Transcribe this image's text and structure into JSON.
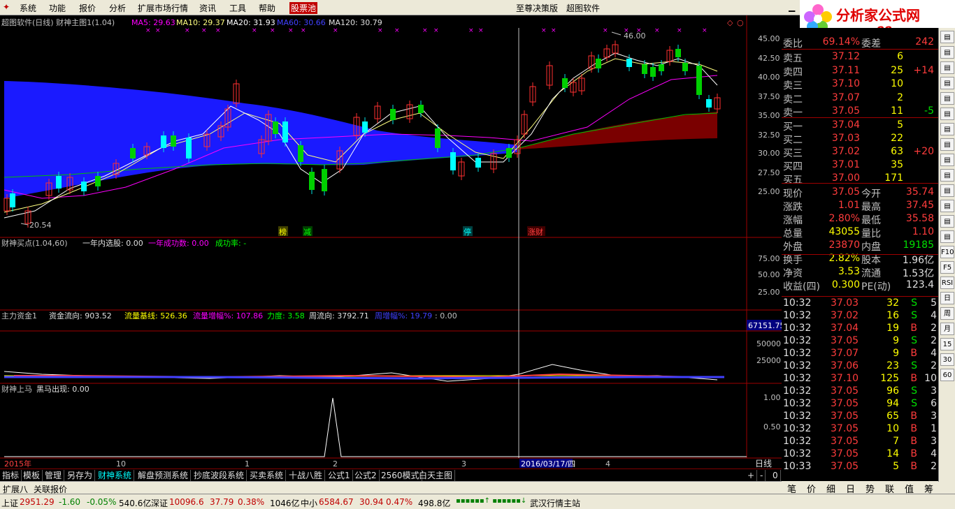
{
  "menu": [
    "系统",
    "功能",
    "报价",
    "分析",
    "扩展市场行情",
    "资讯",
    "工具",
    "帮助",
    "股票池"
  ],
  "center_title": "至尊决策版",
  "center_brand": "超图软件",
  "menu_right_stub": "行",
  "logo": {
    "name": "分析家公式网",
    "url": "www.88gs.com"
  },
  "main_panel": {
    "title": "超图软件(日线) 财神主图1(1.04)",
    "ma5": "MA5: 29.63",
    "ma10": "MA10: 29.37",
    "ma20": "MA20: 31.93",
    "ma60": "MA60: 30.66",
    "ma120": "MA120: 30.79",
    "high_label": "46.00",
    "low_label": "20.54",
    "y_ticks": [
      "45.00",
      "42.50",
      "40.00",
      "37.50",
      "35.00",
      "32.50",
      "30.00",
      "27.50",
      "25.00"
    ],
    "markers": [
      {
        "text": "榜",
        "color": "#ffff00"
      },
      {
        "text": "减",
        "color": "#00ff00"
      },
      {
        "text": "停",
        "color": "#00ffff"
      },
      {
        "text": "涨财",
        "color": "#ff4040"
      }
    ]
  },
  "panel2": {
    "title": "财神买点(1.04,60)",
    "f1": "一年内选股: 0.00",
    "f2": "一年成功数: 0.00",
    "f3": "成功率: -",
    "y_ticks": [
      "75.00",
      "50.00",
      "25.00"
    ]
  },
  "panel3": {
    "title": "主力资金1",
    "f1": "资金流向: 903.52",
    "f2": "流量基线: 526.36",
    "f3": "流量增幅%: 107.86",
    "f4": "力度: 3.58",
    "f5": "周流向: 3792.71",
    "f6": "周增幅%: 19.79",
    "f7": ": 0.00",
    "top_value": "67151.75",
    "y_ticks": [
      "50000",
      "25000"
    ]
  },
  "panel4": {
    "title": "财神上马",
    "f1": "黑马出现: 0.00",
    "y_ticks": [
      "1.00",
      "0.50"
    ]
  },
  "x_axis": {
    "labels": [
      "2015年",
      "10",
      "1",
      "2",
      "3",
      "4"
    ],
    "cursor_date": "2016/03/17/四",
    "period": "日线"
  },
  "tabs": [
    "指标",
    "模板",
    "管理",
    "另存为",
    "财神系统",
    "解盘预测系统",
    "抄底波段系统",
    "买卖系统",
    "十战八胜",
    "公式1",
    "公式2",
    "2560模式",
    "白天主图"
  ],
  "tabs_right": [
    "+",
    "-",
    "0"
  ],
  "subtabs": [
    "扩展八",
    "关联报价"
  ],
  "order_book": {
    "weibi_label": "委比",
    "weibi": "69.14%",
    "weicha_label": "委差",
    "weicha": "242",
    "sells": [
      {
        "l": "卖五",
        "p": "37.12",
        "v": "6",
        "c": ""
      },
      {
        "l": "卖四",
        "p": "37.11",
        "v": "25",
        "c": "+14"
      },
      {
        "l": "卖三",
        "p": "37.10",
        "v": "10",
        "c": ""
      },
      {
        "l": "卖二",
        "p": "37.07",
        "v": "2",
        "c": ""
      },
      {
        "l": "卖一",
        "p": "37.05",
        "v": "11",
        "c": "-5"
      }
    ],
    "buys": [
      {
        "l": "买一",
        "p": "37.04",
        "v": "5",
        "c": ""
      },
      {
        "l": "买二",
        "p": "37.03",
        "v": "22",
        "c": ""
      },
      {
        "l": "买三",
        "p": "37.02",
        "v": "63",
        "c": "+20"
      },
      {
        "l": "买四",
        "p": "37.01",
        "v": "35",
        "c": ""
      },
      {
        "l": "买五",
        "p": "37.00",
        "v": "171",
        "c": ""
      }
    ]
  },
  "quote": [
    {
      "l1": "现价",
      "v1": "37.05",
      "l2": "今开",
      "v2": "35.74"
    },
    {
      "l1": "涨跌",
      "v1": "1.01",
      "l2": "最高",
      "v2": "37.45"
    },
    {
      "l1": "涨幅",
      "v1": "2.80%",
      "l2": "最低",
      "v2": "35.58"
    },
    {
      "l1": "总量",
      "v1": "43055",
      "l2": "量比",
      "v2": "1.10"
    },
    {
      "l1": "外盘",
      "v1": "23870",
      "l2": "内盘",
      "v2": "19185"
    },
    {
      "l1": "换手",
      "v1": "2.82%",
      "l2": "股本",
      "v2": "1.96亿"
    },
    {
      "l1": "净资",
      "v1": "3.53",
      "l2": "流通",
      "v2": "1.53亿"
    },
    {
      "l1": "收益(四)",
      "v1": "0.300",
      "l2": "PE(动)",
      "v2": "123.4"
    }
  ],
  "ticks": [
    {
      "t": "10:32",
      "p": "37.03",
      "v": "32",
      "s": "S",
      "n": "5"
    },
    {
      "t": "10:32",
      "p": "37.02",
      "v": "16",
      "s": "S",
      "n": "4"
    },
    {
      "t": "10:32",
      "p": "37.04",
      "v": "19",
      "s": "B",
      "n": "2"
    },
    {
      "t": "10:32",
      "p": "37.05",
      "v": "9",
      "s": "S",
      "n": "2"
    },
    {
      "t": "10:32",
      "p": "37.07",
      "v": "9",
      "s": "B",
      "n": "4"
    },
    {
      "t": "10:32",
      "p": "37.06",
      "v": "23",
      "s": "S",
      "n": "2"
    },
    {
      "t": "10:32",
      "p": "37.10",
      "v": "125",
      "s": "B",
      "n": "10"
    },
    {
      "t": "10:32",
      "p": "37.05",
      "v": "96",
      "s": "S",
      "n": "3"
    },
    {
      "t": "10:32",
      "p": "37.05",
      "v": "94",
      "s": "S",
      "n": "6"
    },
    {
      "t": "10:32",
      "p": "37.05",
      "v": "65",
      "s": "B",
      "n": "3"
    },
    {
      "t": "10:32",
      "p": "37.05",
      "v": "10",
      "s": "B",
      "n": "1"
    },
    {
      "t": "10:32",
      "p": "37.05",
      "v": "7",
      "s": "B",
      "n": "3"
    },
    {
      "t": "10:32",
      "p": "37.05",
      "v": "14",
      "s": "B",
      "n": "4"
    },
    {
      "t": "10:33",
      "p": "37.05",
      "v": "5",
      "s": "B",
      "n": "2"
    }
  ],
  "right_tabs": [
    "笔",
    "价",
    "细",
    "日",
    "势",
    "联",
    "值",
    "筹"
  ],
  "right_tools": [
    "F10",
    "F5",
    "RSI",
    "日",
    "周",
    "月",
    "15",
    "30",
    "60"
  ],
  "status": {
    "sh_label": "上证",
    "sh": "2951.29",
    "sh_chg": "-1.60",
    "sh_pct": "-0.05%",
    "sh_amt": "540.6亿",
    "sz_label": "深证",
    "sz": "10096.6",
    "sz_chg": "37.79",
    "sz_pct": "0.38%",
    "sz_amt": "1046亿",
    "zx_label": "中小",
    "zx": "6584.67",
    "zx_chg": "30.94",
    "zx_pct": "0.47%",
    "zx_amt": "498.8亿",
    "server": "武汉行情主站"
  }
}
